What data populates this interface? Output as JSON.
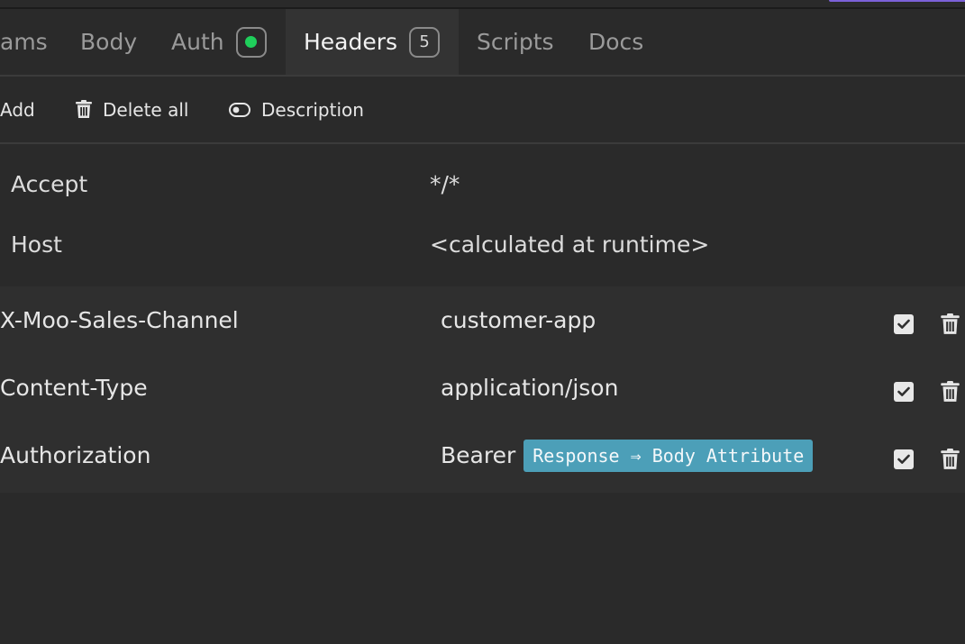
{
  "colors": {
    "accent_strip": "#7b61d8",
    "auth_dot": "#1fcf5b",
    "token_bg": "#4c9fb8"
  },
  "tabs": [
    {
      "label": "ams"
    },
    {
      "label": "Body"
    },
    {
      "label": "Auth",
      "badge_icon": "status-dot-icon"
    },
    {
      "label": "Headers",
      "badge": "5",
      "active": true
    },
    {
      "label": "Scripts"
    },
    {
      "label": "Docs"
    }
  ],
  "toolbar": {
    "add_label": "Add",
    "delete_all_label": "Delete all",
    "description_label": "Description"
  },
  "auto_headers": [
    {
      "key": "Accept",
      "value": "*/*"
    },
    {
      "key": "Host",
      "value": "<calculated at runtime>"
    }
  ],
  "headers": [
    {
      "key": "X-Moo-Sales-Channel",
      "value": "customer-app",
      "enabled": true
    },
    {
      "key": "Content-Type",
      "value": "application/json",
      "enabled": true
    },
    {
      "key": "Authorization",
      "value": "Bearer",
      "token": "Response ⇒ Body Attribute",
      "enabled": true
    }
  ]
}
